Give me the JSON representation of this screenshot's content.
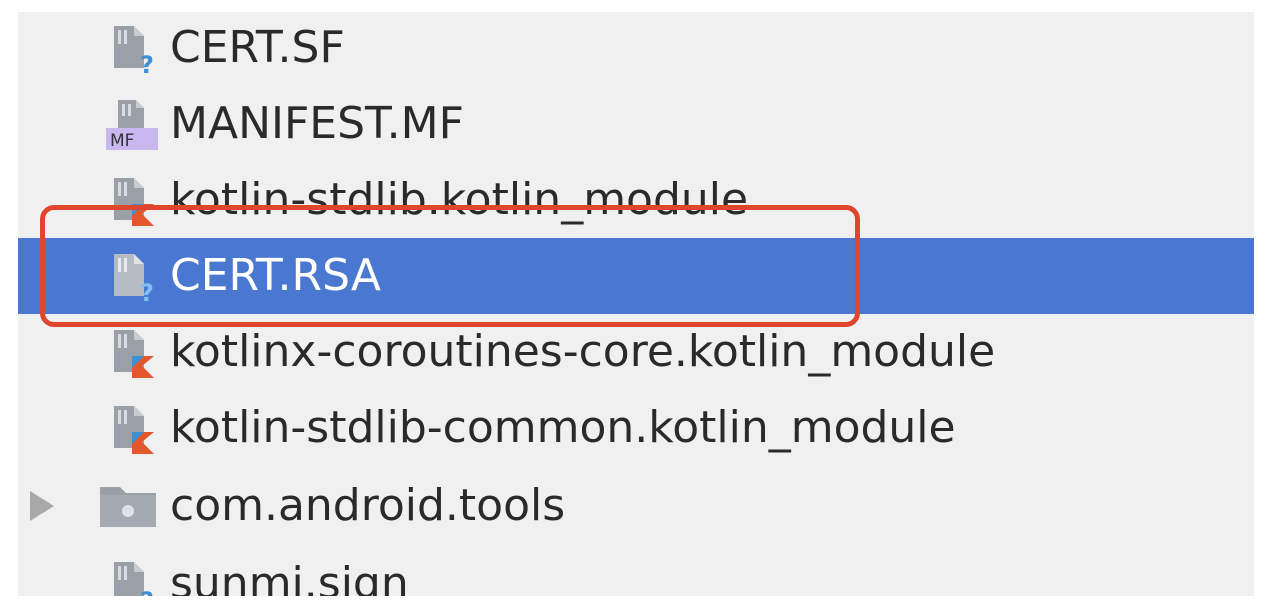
{
  "tree": {
    "items": [
      {
        "label": "CERT.SF",
        "icon": "unknown-file-icon",
        "selected": false
      },
      {
        "label": "MANIFEST.MF",
        "icon": "manifest-file-icon",
        "badge": "MF",
        "selected": false
      },
      {
        "label": "kotlin-stdlib.kotlin_module",
        "icon": "kotlin-module-file-icon",
        "selected": false
      },
      {
        "label": "CERT.RSA",
        "icon": "unknown-file-icon",
        "selected": true
      },
      {
        "label": "kotlinx-coroutines-core.kotlin_module",
        "icon": "kotlin-module-file-icon",
        "selected": false
      },
      {
        "label": "kotlin-stdlib-common.kotlin_module",
        "icon": "kotlin-module-file-icon",
        "selected": false
      },
      {
        "label": "com.android.tools",
        "icon": "package-folder-icon",
        "expandable": true,
        "selected": false
      },
      {
        "label": "sunmi.sign",
        "icon": "unknown-file-icon",
        "selected": false
      }
    ]
  },
  "annotation": {
    "color": "#e0462e",
    "target": "CERT.RSA"
  },
  "colors": {
    "selection": "#4a78d0",
    "background": "#f0f0f0",
    "kotlin_accent": "#e3572c",
    "unknown_accent": "#3d8fd6",
    "manifest_badge": "#c9b8f0"
  }
}
